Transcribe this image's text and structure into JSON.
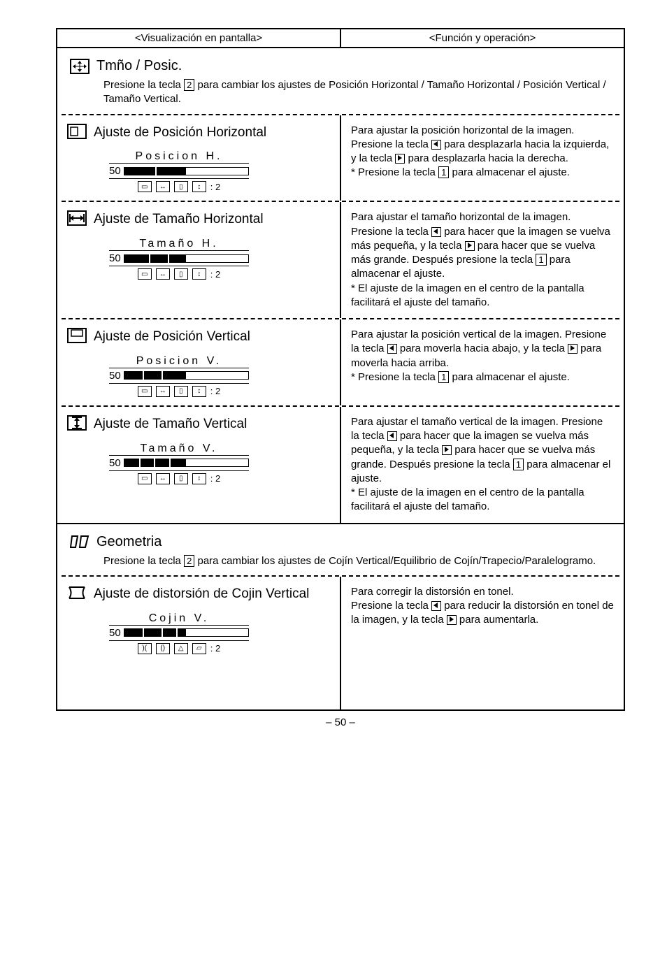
{
  "header": {
    "left": "<Visualización en pantalla>",
    "right": "<Función y operación>"
  },
  "section1": {
    "title": "Tmño / Posic.",
    "desc_a": "Presione la tecla ",
    "key": "2",
    "desc_b": " para cambiar los ajustes de Posición Horizontal / Tamaño Horizontal / Posición Vertical / Tamaño Vertical."
  },
  "r1": {
    "title": "Ajuste de Posición Horizontal",
    "osd_title": "Posicion H.",
    "osd_val": "50",
    "func_a": "Para ajustar la posición horizontal de la imagen. Presione la tecla ",
    "func_b": " para desplazarla hacia la izquierda, y la tecla ",
    "func_c": " para desplazarla hacia la derecha.",
    "func_d": "* Presione la tecla ",
    "key1": "1",
    "func_e": " para almacenar el ajuste."
  },
  "r2": {
    "title": "Ajuste de Tamaño Horizontal",
    "osd_title": "Tamaño H.",
    "osd_val": "50",
    "func_a": "Para ajustar el tamaño horizontal de la imagen. Presione la tecla ",
    "func_b": " para hacer que la imagen se vuelva más pequeña, y la tecla ",
    "func_c": " para hacer que se vuelva más grande.  Después presione la tecla ",
    "key1": "1",
    "func_d": " para almacenar el ajuste.",
    "func_e": "* El ajuste de la imagen en el centro de la pantalla facilitará el ajuste del tamaño."
  },
  "r3": {
    "title": "Ajuste de Posición Vertical",
    "osd_title": "Posicion V.",
    "osd_val": "50",
    "func_a": "Para ajustar la posición vertical de la imagen. Presione la tecla ",
    "func_b": " para moverla hacia abajo, y la tecla ",
    "func_c": " para moverla hacia arriba.",
    "func_d": "* Presione la tecla ",
    "key1": "1",
    "func_e": " para almacenar el ajuste."
  },
  "r4": {
    "title": "Ajuste de Tamaño Vertical",
    "osd_title": "Tamaño V.",
    "osd_val": "50",
    "func_a": "Para ajustar el tamaño vertical de la imagen. Presione la tecla ",
    "func_b": " para hacer que la imagen se vuelva más pequeña, y la tecla ",
    "func_c": " para hacer que se vuelva más grande.  Después presione la tecla ",
    "key1": "1",
    "func_d": " para almacenar el ajuste.",
    "func_e": "* El ajuste de la imagen en el centro de la pantalla facilitará el ajuste del tamaño."
  },
  "section2": {
    "title": "Geometria",
    "desc_a": "Presione la tecla ",
    "key": "2",
    "desc_b": " para cambiar los ajustes de Cojín Vertical/Equilibrio de Cojín/Trapecio/Paralelogramo."
  },
  "r5": {
    "title": "Ajuste de distorsión de Cojin Vertical",
    "osd_title": "Cojin V.",
    "osd_val": "50",
    "func_a": "Para corregir la distorsión en tonel.",
    "func_b": "Presione la tecla ",
    "func_c": " para reducir la distorsión en tonel de la imagen, y la tecla ",
    "func_d": " para aumentarla."
  },
  "osd_tail": ": 2",
  "pagenum": "– 50 –"
}
